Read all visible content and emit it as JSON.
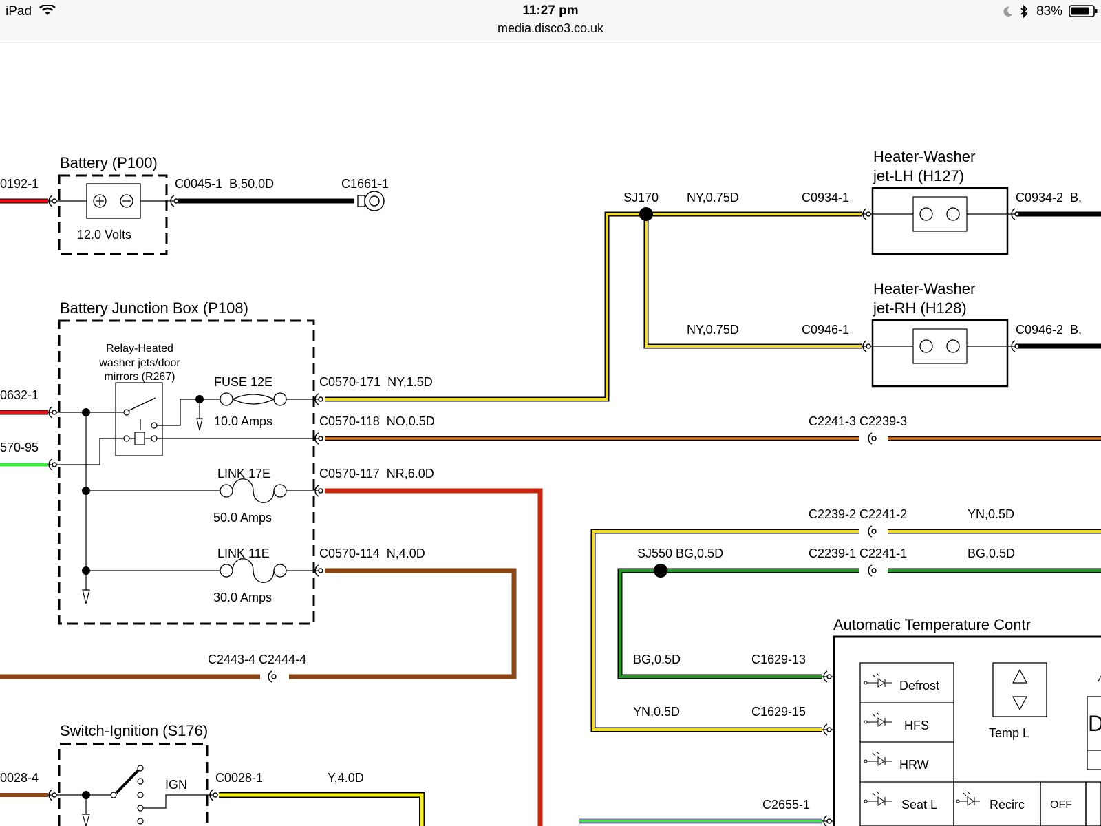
{
  "status_bar": {
    "device": "iPad",
    "time": "11:27 pm",
    "url": "media.disco3.co.uk",
    "battery_percent": "83%"
  },
  "diagram": {
    "components": {
      "battery": {
        "title": "Battery (P100)",
        "voltage": "12.0 Volts"
      },
      "bjb": {
        "title": "Battery Junction Box (P108)",
        "relay_line1": "Relay-Heated",
        "relay_line2": "washer jets/door",
        "relay_line3": "mirrors (R267)",
        "fuse_name": "FUSE 12E",
        "fuse_rating": "10.0 Amps",
        "link17_name": "LINK 17E",
        "link17_rating": "50.0 Amps",
        "link11_name": "LINK 11E",
        "link11_rating": "30.0 Amps"
      },
      "washer_lh": {
        "title_line1": "Heater-Washer",
        "title_line2": "jet-LH (H127)"
      },
      "washer_rh": {
        "title_line1": "Heater-Washer",
        "title_line2": "jet-RH (H128)"
      },
      "ignition": {
        "title": "Switch-Ignition (S176)",
        "ign": "IGN"
      },
      "atc": {
        "title": "Automatic Temperature Contr",
        "buttons": [
          "Defrost",
          "HFS",
          "HRW",
          "Seat L",
          "Recirc",
          "OFF"
        ],
        "temp_label": "Temp L",
        "partial_display": "D"
      }
    },
    "labels": {
      "c0192": "0192-1",
      "c0632": "0632-1",
      "c0570_95": "570-95",
      "c0045": "C0045-1  B,50.0D",
      "c1661": "C1661-1",
      "sj170": "SJ170",
      "ny075_top": "NY,0.75D",
      "c0934_1": "C0934-1",
      "c0934_2": "C0934-2  B,",
      "ny075_rh": "NY,0.75D",
      "c0946_1": "C0946-1",
      "c0946_2": "C0946-2  B,",
      "c0570_171": "C0570-171  NY,1.5D",
      "c0570_118": "C0570-118  NO,0.5D",
      "c2241_3": "C2241-3 C2239-3",
      "c0570_117": "C0570-117  NR,6.0D",
      "c0570_114": "C0570-114  N,4.0D",
      "c2239_2": "C2239-2 C2241-2",
      "yn05_top": "YN,0.5D",
      "sj550": "SJ550 BG,0.5D",
      "c2239_1": "C2239-1 C2241-1",
      "bg05_right": "BG,0.5D",
      "bg05_left": "BG,0.5D",
      "c1629_13": "C1629-13",
      "yn05_left": "YN,0.5D",
      "c1629_15": "C1629-15",
      "c2443": "C2443-4 C2444-4",
      "c0028_4": "0028-4",
      "c0028_1": "C0028-1",
      "y40": "Y,4.0D",
      "c2655": "C2655-1"
    },
    "wire_colors": {
      "red": "#e8121b",
      "black": "#000000",
      "yellow": "#f3dd2a",
      "orange": "#e87a14",
      "dark_red": "#c8260e",
      "brown": "#8b4413",
      "green": "#19a219",
      "bright_green": "#35f035",
      "bright_yellow": "#f5ef1e"
    }
  }
}
